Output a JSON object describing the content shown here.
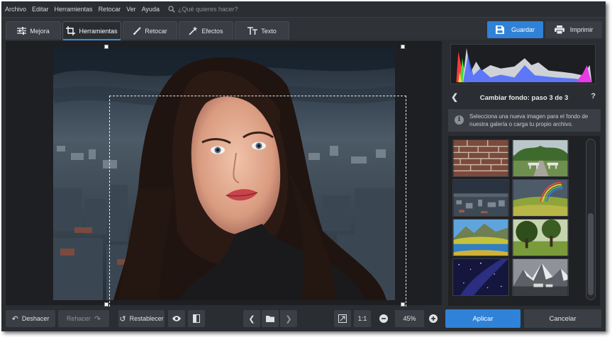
{
  "menubar": {
    "items": [
      "Archivo",
      "Editar",
      "Herramientas",
      "Retocar",
      "Ver",
      "Ayuda"
    ],
    "search_placeholder": "¿Qué quieres hacer?"
  },
  "tabs": [
    {
      "label": "Mejora",
      "icon": "sliders-icon",
      "active": false
    },
    {
      "label": "Herramientas",
      "icon": "crop-icon",
      "active": true
    },
    {
      "label": "Retocar",
      "icon": "brush-icon",
      "active": false
    },
    {
      "label": "Efectos",
      "icon": "magic-wand-icon",
      "active": false
    },
    {
      "label": "Texto",
      "icon": "text-icon",
      "active": false
    }
  ],
  "toolbar": {
    "save_label": "Guardar",
    "print_label": "Imprimir"
  },
  "panel": {
    "step_title": "Cambiar fondo: paso 3 de 3",
    "help_label": "?",
    "info_text": "Selecciona una nueva imagen para el fondo de nuestra galería o carga tu propio archivo.",
    "gallery": [
      {
        "name": "brick-wall"
      },
      {
        "name": "park-bench"
      },
      {
        "name": "stormy-city"
      },
      {
        "name": "rainbow-field"
      },
      {
        "name": "mountain-lake"
      },
      {
        "name": "green-trees"
      },
      {
        "name": "starry-night"
      },
      {
        "name": "snowy-mountains"
      }
    ]
  },
  "bottombar": {
    "undo_label": "Deshacer",
    "redo_label": "Rehacer",
    "reset_label": "Restablecer",
    "actual_size_label": "1:1",
    "zoom_value": "45%",
    "apply_label": "Aplicar",
    "cancel_label": "Cancelar"
  },
  "colors": {
    "accent": "#2f82d8",
    "background": "#2a2d31"
  }
}
